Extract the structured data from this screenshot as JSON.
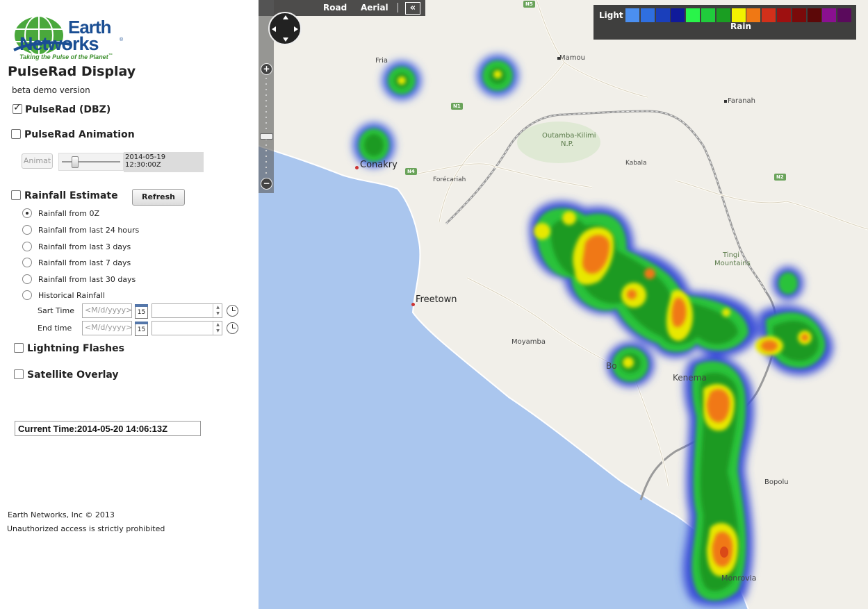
{
  "logo": {
    "line1": "Earth",
    "line2": "Networks",
    "tm": "®",
    "tagline": "Taking the Pulse of the Planet",
    "tagline_tm": "™"
  },
  "app": {
    "title": "PulseRad Display",
    "subtitle": "beta demo version"
  },
  "layers": {
    "pulserad": {
      "label": "PulseRad (DBZ)",
      "checked": true
    },
    "animation": {
      "label": "PulseRad Animation",
      "checked": false
    },
    "rainfall": {
      "label": "Rainfall Estimate",
      "checked": false
    },
    "lightning": {
      "label": "Lightning Flashes",
      "checked": false
    },
    "satellite": {
      "label": "Satellite Overlay",
      "checked": false
    }
  },
  "animation": {
    "button_label": "Animat",
    "timestamp": "2014-05-19 12:30:00Z",
    "slider_level": 0.18
  },
  "rainfall": {
    "refresh_label": "Refresh",
    "options": [
      "Rainfall from 0Z",
      "Rainfall from last 24 hours",
      "Rainfall from last 3 days",
      "Rainfall from last 7 days",
      "Rainfall from last 30 days",
      "Historical Rainfall"
    ],
    "selected_index": 0,
    "start_label": "Sart Time",
    "end_label": "End time",
    "date_placeholder": "<M/d/yyyy>",
    "calendar_day": "15"
  },
  "current_time": "Current Time:2014-05-20 14:06:13Z",
  "footer": {
    "copyright": "Earth Networks, Inc © 2013",
    "notice": "Unauthorized access is strictly prohibited"
  },
  "map": {
    "tabs": {
      "road": "Road",
      "aerial": "Aerial",
      "collapse": "«"
    },
    "legend": {
      "light_label": "Light",
      "rain_label": "Rain",
      "colors": [
        "#4b8ff0",
        "#2f6fe0",
        "#1a3fbb",
        "#101a9a",
        "#29f44a",
        "#20cc3c",
        "#1a9e22",
        "#f2f200",
        "#f07814",
        "#d2301a",
        "#9e1010",
        "#7a0a0a",
        "#5c0808",
        "#8a1090",
        "#5a0a5c"
      ]
    },
    "places": {
      "fria": "Fria",
      "mamou": "Mamou",
      "faranah": "Faranah",
      "conakry": "Conakry",
      "forecariah": "Forécariah",
      "outamba": "Outamba-Kilimi",
      "np": "N.P.",
      "kabala": "Kabala",
      "tingi1": "Tingi",
      "tingi2": "Mountains",
      "freetown": "Freetown",
      "moyamba": "Moyamba",
      "bo": "Bo",
      "kenema": "Kenema",
      "bopolu": "Bopolu",
      "monrovia": "Monrovia"
    },
    "roads": {
      "n1": "N1",
      "n4": "N4",
      "n2": "N2",
      "n5": "N5"
    }
  }
}
